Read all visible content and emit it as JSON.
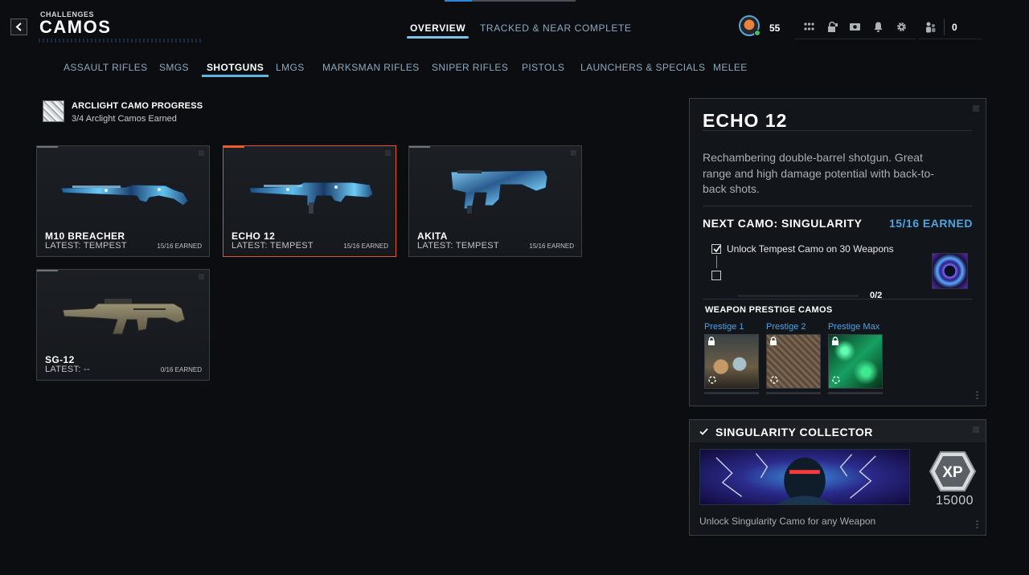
{
  "header": {
    "breadcrumb": "CHALLENGES",
    "title": "CAMOS",
    "tabs": [
      {
        "label": "OVERVIEW",
        "active": true
      },
      {
        "label": "TRACKED & NEAR COMPLETE",
        "active": false
      }
    ],
    "player_level": "55",
    "party_count": "0",
    "icons": [
      "apps-icon",
      "unlock-icon",
      "media-icon",
      "bell-icon",
      "gear-icon",
      "social-icon"
    ]
  },
  "categories": [
    {
      "label": "ASSAULT RIFLES",
      "active": false
    },
    {
      "label": "SMGS",
      "active": false
    },
    {
      "label": "SHOTGUNS",
      "active": true
    },
    {
      "label": "LMGS",
      "active": false
    },
    {
      "label": "MARKSMAN RIFLES",
      "active": false
    },
    {
      "label": "SNIPER RIFLES",
      "active": false
    },
    {
      "label": "PISTOLS",
      "active": false
    },
    {
      "label": "LAUNCHERS & SPECIALS",
      "active": false
    },
    {
      "label": "MELEE",
      "active": false
    }
  ],
  "progress": {
    "title": "ARCLIGHT CAMO PROGRESS",
    "subtitle": "3/4 Arclight Camos Earned"
  },
  "weapons": [
    {
      "name": "M10 BREACHER",
      "latest": "LATEST: TEMPEST",
      "earned": "15/16 EARNED",
      "selected": false,
      "camo": "tempest"
    },
    {
      "name": "ECHO 12",
      "latest": "LATEST: TEMPEST",
      "earned": "15/16 EARNED",
      "selected": true,
      "camo": "tempest"
    },
    {
      "name": "AKITA",
      "latest": "LATEST: TEMPEST",
      "earned": "15/16 EARNED",
      "selected": false,
      "camo": "tempest"
    },
    {
      "name": "SG-12",
      "latest": "LATEST: --",
      "earned": "0/16 EARNED",
      "selected": false,
      "camo": "none"
    }
  ],
  "details": {
    "weapon_name": "ECHO 12",
    "description": "Rechambering double-barrel shotgun. Great range and high damage potential with back-to-back shots.",
    "next_camo_label": "NEXT CAMO: SINGULARITY",
    "next_camo_earned": "15/16 EARNED",
    "challenge_text": "Unlock Tempest Camo on 30 Weapons",
    "challenge_checked": true,
    "challenge_count": "0/2",
    "challenge_progress": 0,
    "prestige_title": "WEAPON PRESTIGE CAMOS",
    "prestige": [
      {
        "label": "Prestige 1"
      },
      {
        "label": "Prestige 2"
      },
      {
        "label": "Prestige Max"
      }
    ]
  },
  "reward": {
    "title": "SINGULARITY COLLECTOR",
    "xp": "15000",
    "xp_badge_text": "XP",
    "description": "Unlock Singularity Camo for any Weapon"
  },
  "colors": {
    "accent_blue": "#4ea3e2",
    "selected_orange": "#e0562e",
    "tab_underline": "#5fb4e4",
    "background": "#0b0d10"
  }
}
